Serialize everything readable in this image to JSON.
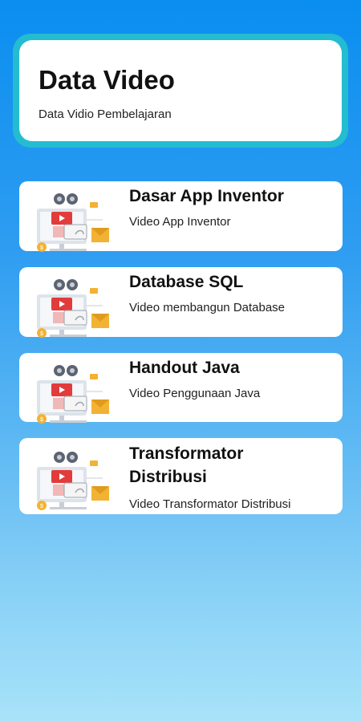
{
  "header": {
    "title": "Data Video",
    "subtitle": "Data Vidio Pembelajaran"
  },
  "items": [
    {
      "title": "Dasar App Inventor",
      "subtitle": "Video App Inventor",
      "icon": "video-tutorial-icon"
    },
    {
      "title": "Database SQL",
      "subtitle": "Video membangun Database",
      "icon": "video-tutorial-icon"
    },
    {
      "title": "Handout Java",
      "subtitle": "Video Penggunaan Java",
      "icon": "video-tutorial-icon"
    },
    {
      "title": "Transformator Distribusi",
      "subtitle": "Video Transformator Distribusi",
      "icon": "video-tutorial-icon"
    }
  ],
  "colors": {
    "header_border": "#23bcd0",
    "background_top": "#0a8ef0",
    "background_bottom": "#a8e3f8",
    "thumb_red": "#e23b3b",
    "thumb_gold": "#f2b233"
  }
}
